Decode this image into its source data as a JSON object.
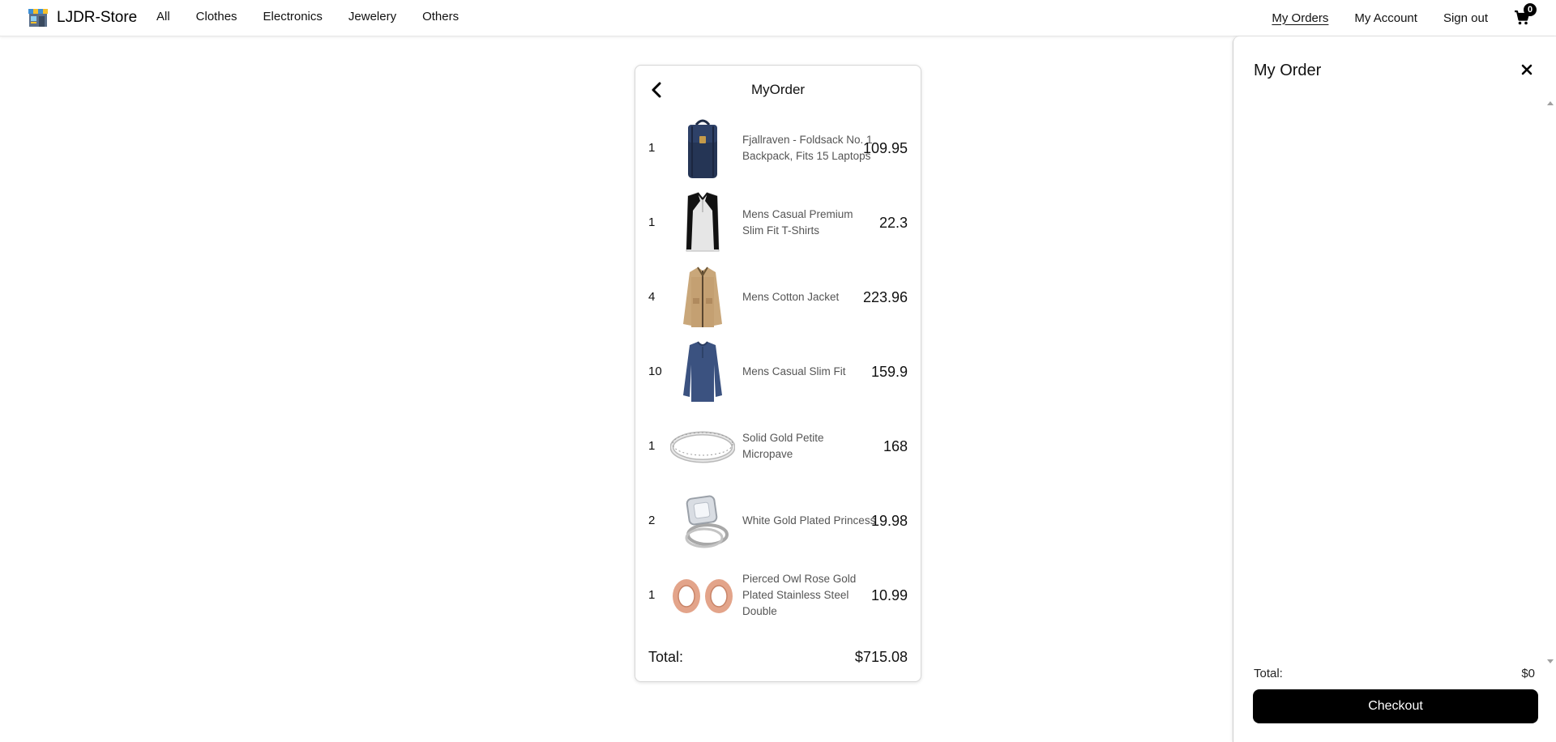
{
  "navbar": {
    "brand": "LJDR-Store",
    "links": [
      "All",
      "Clothes",
      "Electronics",
      "Jewelery",
      "Others"
    ],
    "my_orders": "My Orders",
    "my_account": "My Account",
    "sign_out": "Sign out",
    "cart_count": "0"
  },
  "order": {
    "title": "MyOrder",
    "items": [
      {
        "qty": "1",
        "name": "Fjallraven - Foldsack No. 1 Backpack, Fits 15 Laptops",
        "price": "109.95",
        "icon": "backpack"
      },
      {
        "qty": "1",
        "name": "Mens Casual Premium Slim Fit T-Shirts",
        "price": "22.3",
        "icon": "raglan-tshirt"
      },
      {
        "qty": "4",
        "name": "Mens Cotton Jacket",
        "price": "223.96",
        "icon": "jacket"
      },
      {
        "qty": "10",
        "name": "Mens Casual Slim Fit",
        "price": "159.9",
        "icon": "long-sleeve-shirt"
      },
      {
        "qty": "1",
        "name": "Solid Gold Petite Micropave",
        "price": "168",
        "icon": "ring-band"
      },
      {
        "qty": "2",
        "name": "White Gold Plated Princess",
        "price": "19.98",
        "icon": "diamond-ring"
      },
      {
        "qty": "1",
        "name": "Pierced Owl Rose Gold Plated Stainless Steel Double",
        "price": "10.99",
        "icon": "rose-gold-plugs"
      }
    ],
    "total_label": "Total:",
    "total_value": "$715.08"
  },
  "side_panel": {
    "title": "My Order",
    "total_label": "Total:",
    "total_value": "$0",
    "checkout_label": "Checkout"
  },
  "colors": {
    "accent": "#000000",
    "text_muted": "#555555",
    "border": "#d7d7d7"
  }
}
